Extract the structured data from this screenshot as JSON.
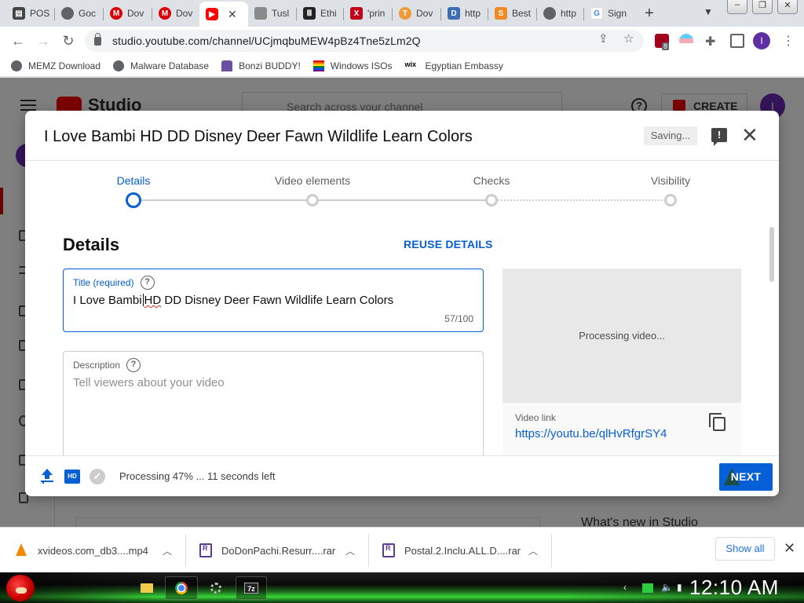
{
  "browser": {
    "tabs": [
      {
        "label": "POS",
        "favicon": "pos-doc-icon",
        "color": "#444444"
      },
      {
        "label": "Goc",
        "favicon": "globe-icon",
        "color": "#5f6368"
      },
      {
        "label": "Dov",
        "favicon": "mega-icon",
        "color": "#d90007"
      },
      {
        "label": "Dov",
        "favicon": "mega-icon",
        "color": "#d90007"
      },
      {
        "label": "",
        "favicon": "youtube-icon",
        "color": "#ff0000",
        "active": true
      },
      {
        "label": "Tusl",
        "favicon": "castle-icon",
        "color": "#8a8a8a"
      },
      {
        "label": "Ethi",
        "favicon": "museum-icon",
        "color": "#222222"
      },
      {
        "label": "'prin",
        "favicon": "x-icon",
        "color": "#c0001a"
      },
      {
        "label": "Dov",
        "favicon": "t-orange-icon",
        "color": "#f09a36"
      },
      {
        "label": "http",
        "favicon": "d-page-icon",
        "color": "#3d6db5"
      },
      {
        "label": "Best",
        "favicon": "s-orange-icon",
        "color": "#f08a24"
      },
      {
        "label": "http",
        "favicon": "globe-icon",
        "color": "#5f6368"
      },
      {
        "label": "Sign",
        "favicon": "google-icon",
        "color": "#4285f4"
      }
    ],
    "url": "studio.youtube.com/channel/UCjmqbuMEW4pBz4Tne5zLm2Q",
    "profile_initial": "I",
    "extension_badge": "8",
    "bookmarks": [
      {
        "label": "MEMZ Download",
        "icon": "globe-icon"
      },
      {
        "label": "Malware Database",
        "icon": "globe-icon"
      },
      {
        "label": "Bonzi BUDDY!",
        "icon": "bonzi-icon"
      },
      {
        "label": "Windows ISOs",
        "icon": "windows-flag-icon"
      },
      {
        "label": "Egyptian Embassy",
        "icon": "wix-icon"
      }
    ]
  },
  "studio_bg": {
    "logo_text": "Studio",
    "search_placeholder": "Search across your channel",
    "create_label": "CREATE",
    "avatar_initial": "I",
    "whats_new": "What's new in Studio"
  },
  "modal": {
    "title": "I Love Bambi HD DD Disney Deer Fawn Wildlife Learn Colors",
    "saving_label": "Saving...",
    "steps": [
      "Details",
      "Video elements",
      "Checks",
      "Visibility"
    ],
    "active_step": 0,
    "heading": "Details",
    "reuse_label": "REUSE DETAILS",
    "title_field": {
      "label": "Title (required)",
      "value_before_caret": "I Love Bambi",
      "value_misspelled": "HD",
      "value_after": " DD Disney Deer Fawn Wildlife Learn Colors",
      "counter": "57/100"
    },
    "description_field": {
      "label": "Description",
      "placeholder": "Tell viewers about your video"
    },
    "preview_text": "Processing video...",
    "video_link_label": "Video link",
    "video_link": "https://youtu.be/qlHvRfgrSY4",
    "status": "Processing 47% ... 11 seconds left",
    "progress_percent": 47,
    "next_label": "NEXT"
  },
  "downloads": {
    "items": [
      {
        "name": "xvideos.com_db3....mp4",
        "icon": "vlc-cone-icon"
      },
      {
        "name": "DoDonPachi.Resurr....rar",
        "icon": "winrar-icon"
      },
      {
        "name": "Postal.2.Inclu.ALL.D....rar",
        "icon": "winrar-icon"
      }
    ],
    "show_all": "Show all"
  },
  "taskbar": {
    "clock": "12:10 AM"
  }
}
